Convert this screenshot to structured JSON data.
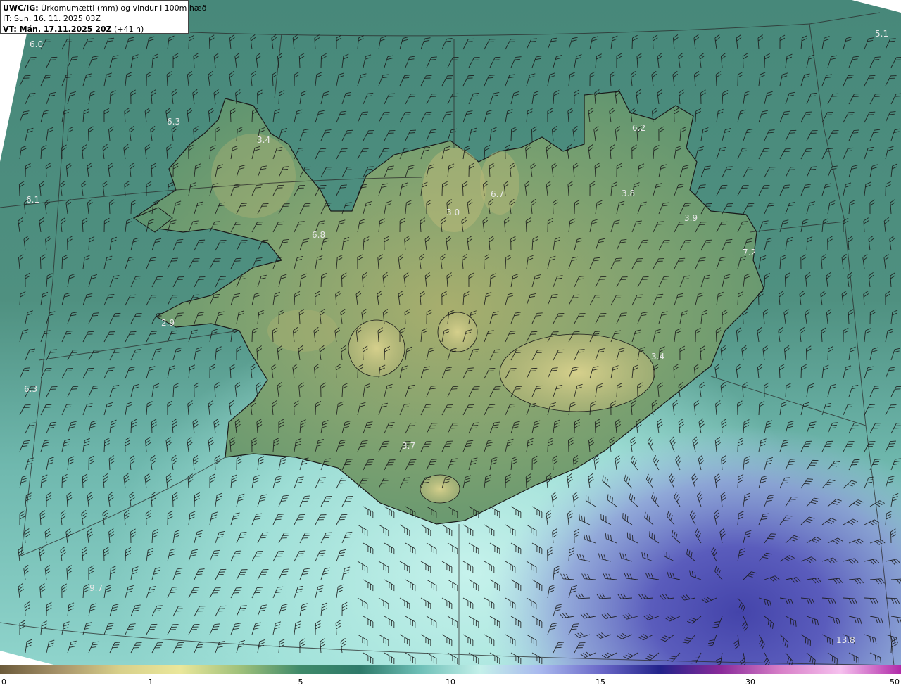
{
  "header": {
    "line1_bold": "UWC/IG:",
    "line1_text": " Úrkomumætti (mm) og vindur i 100m hæð",
    "line2_text": "IT: Sun. 16. 11. 2025 03Z",
    "line3_bold": "VT: Mán. 17.11.2025 20Z",
    "line3_text": " (+41 h)"
  },
  "value_labels": [
    {
      "text": "6.0"
    },
    {
      "text": "5.1"
    },
    {
      "text": "6.3"
    },
    {
      "text": "3.4"
    },
    {
      "text": "6.2"
    },
    {
      "text": "6.7"
    },
    {
      "text": "3.8"
    },
    {
      "text": "6.1"
    },
    {
      "text": "3.0"
    },
    {
      "text": "3.9"
    },
    {
      "text": "6.8"
    },
    {
      "text": "7.2"
    },
    {
      "text": "2.9"
    },
    {
      "text": "3.4"
    },
    {
      "text": "6.3"
    },
    {
      "text": "3.7"
    },
    {
      "text": "9.7"
    },
    {
      "text": "13.8"
    }
  ],
  "colorbar": {
    "ticks": [
      "0",
      "1",
      "5",
      "10",
      "15",
      "30",
      "50"
    ],
    "colors": [
      "#6b5a3a",
      "#a8946a",
      "#d8d08a",
      "#eae79a",
      "#9ec07a",
      "#3f8a6a",
      "#2e7a6a",
      "#6fc0b8",
      "#c4f0ea",
      "#a8b8ee",
      "#6a68c8",
      "#22228a",
      "#8a2a9a",
      "#d880c8",
      "#f6c0ee",
      "#b02aa8"
    ]
  },
  "colors": {
    "ocean_north": "#4a8a80",
    "ocean_south_light": "#a8e6de",
    "low_center": "#5a5ab8",
    "land_low": "#5e9470",
    "land_high": "#c8c47c"
  }
}
